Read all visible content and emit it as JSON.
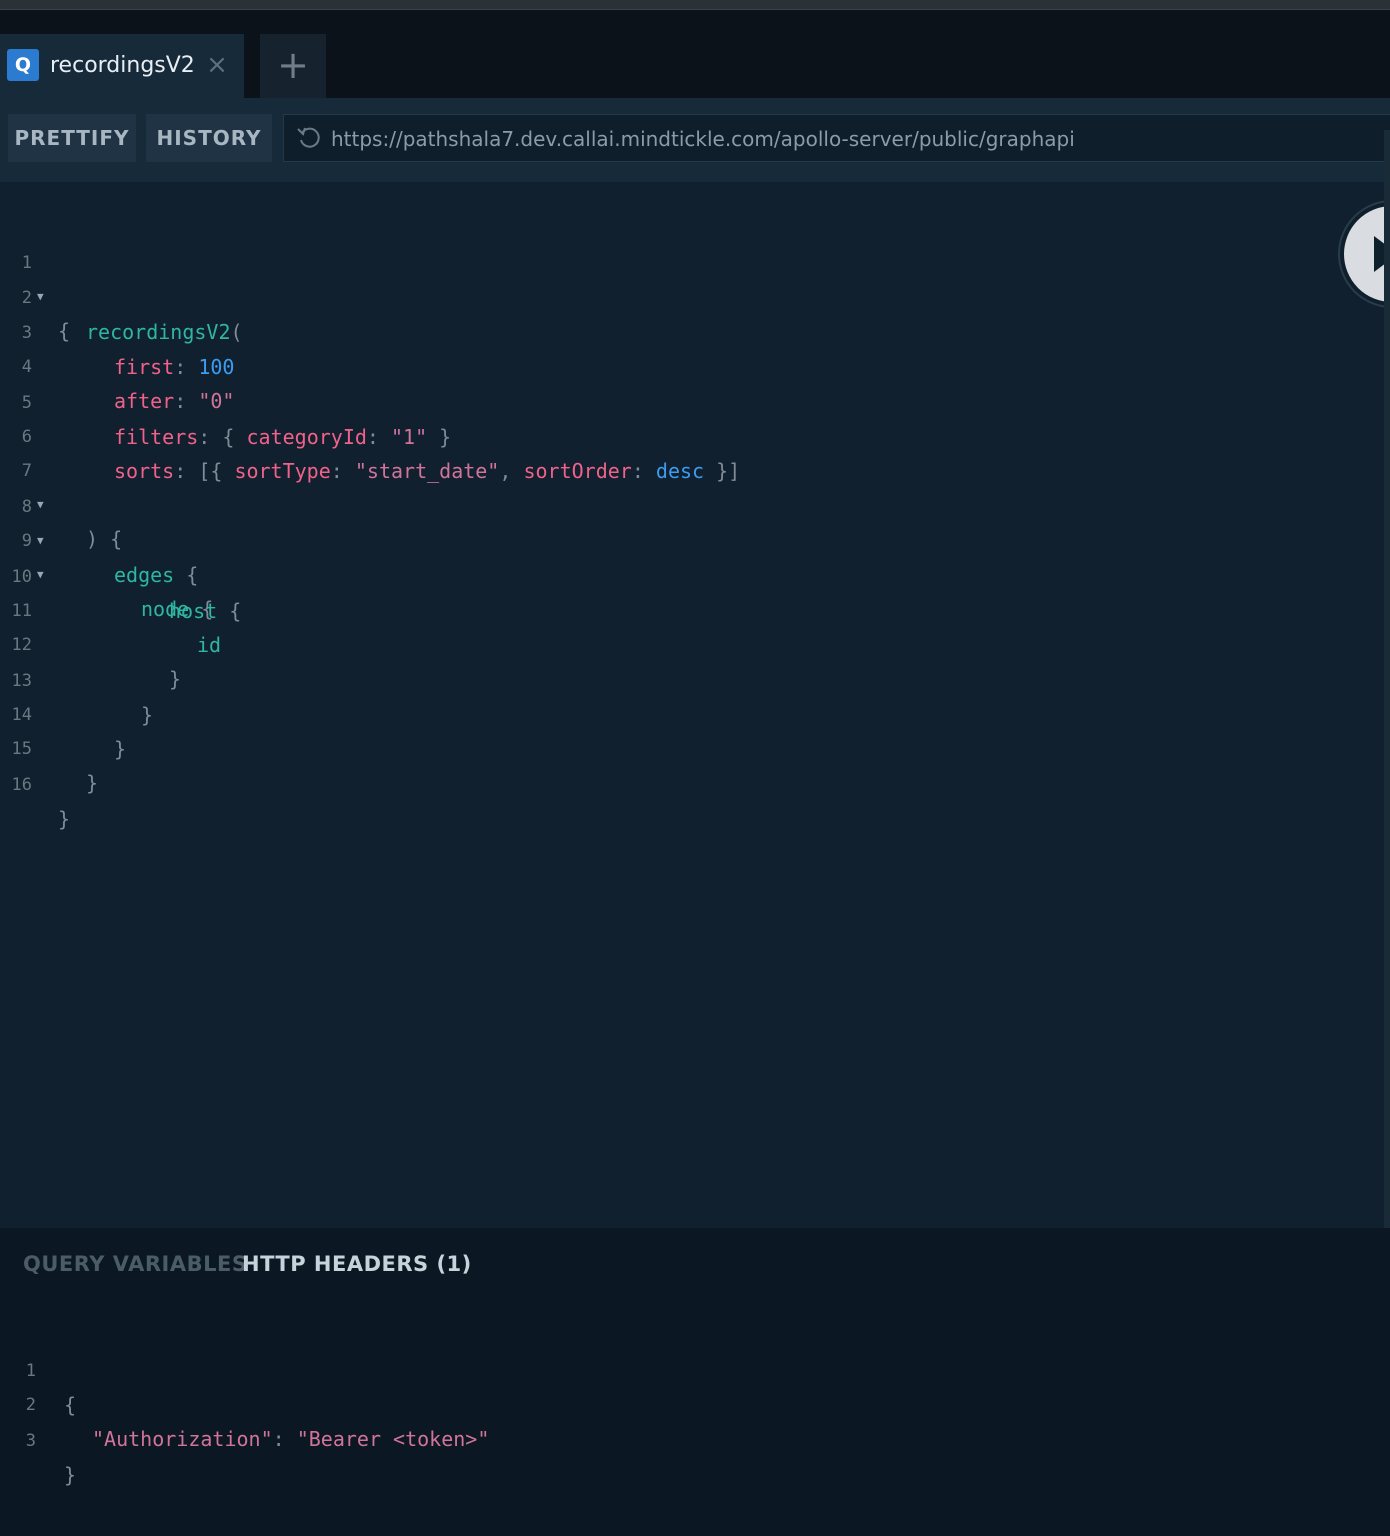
{
  "tabs": [
    {
      "badge": "Q",
      "title": "recordingsV2",
      "close": "×"
    }
  ],
  "add_tab_label": "+",
  "toolbar": {
    "prettify_label": "PRETTIFY",
    "history_label": "HISTORY",
    "endpoint_url": "https://pathshala7.dev.callai.mindtickle.com/apollo-server/public/graphapi"
  },
  "editor": {
    "lines": [
      {
        "n": "1",
        "fold": true
      },
      {
        "n": "2",
        "fold": false
      },
      {
        "n": "3",
        "fold": false
      },
      {
        "n": "4",
        "fold": false
      },
      {
        "n": "5",
        "fold": false
      },
      {
        "n": "6",
        "fold": false
      },
      {
        "n": "7",
        "fold": true
      },
      {
        "n": "8",
        "fold": true
      },
      {
        "n": "9",
        "fold": true
      },
      {
        "n": "10",
        "fold": false
      },
      {
        "n": "11",
        "fold": false
      },
      {
        "n": "12",
        "fold": false
      },
      {
        "n": "13",
        "fold": false
      },
      {
        "n": "14",
        "fold": false
      },
      {
        "n": "15",
        "fold": false
      },
      {
        "n": "16",
        "fold": false
      }
    ],
    "tokens": {
      "l1_open": "{",
      "l2_field": "recordingsV2",
      "l2_paren": "(",
      "l3_key": "first",
      "l3_colon": ": ",
      "l3_val": "100",
      "l4_key": "after",
      "l4_colon": ": ",
      "l4_val": "\"0\"",
      "l5_key": "filters",
      "l5_colon": ": ",
      "l5_brace_open": "{ ",
      "l5_subkey": "categoryId",
      "l5_subcolon": ": ",
      "l5_val": "\"1\"",
      "l5_brace_close": " }",
      "l6_key": "sorts",
      "l6_colon": ": ",
      "l6_open": "[{ ",
      "l6_k1": "sortType",
      "l6_c1": ": ",
      "l6_v1": "\"start_date\"",
      "l6_comma": ", ",
      "l6_k2": "sortOrder",
      "l6_c2": ": ",
      "l6_v2": "desc",
      "l6_close": " }]",
      "l7": ") {",
      "l8_field": "edges",
      "l8_brace": " {",
      "l9_field": "node",
      "l9_brace": " {",
      "l10_field": "host",
      "l10_brace": " {",
      "l11_field": "id",
      "l12": "}",
      "l13": "}",
      "l14": "}",
      "l15": "}",
      "l16": "}"
    },
    "fold_glyph": "▼"
  },
  "run_button_icon": "play-icon",
  "bottom_panel": {
    "query_variables_label": "QUERY VARIABLES",
    "http_headers_label": "HTTP HEADERS (1)",
    "lines": [
      {
        "n": "1",
        "text": "{"
      },
      {
        "n": "2",
        "key": "\"Authorization\"",
        "colon": ": ",
        "value": "\"Bearer <token>\""
      },
      {
        "n": "3",
        "text": "}"
      }
    ]
  },
  "colors": {
    "background": "#0f202d",
    "field": "#2fb6a2",
    "argument": "#f0628a",
    "number": "#3b9cf0",
    "string": "#d1749a",
    "accent": "#2b7bd1"
  }
}
